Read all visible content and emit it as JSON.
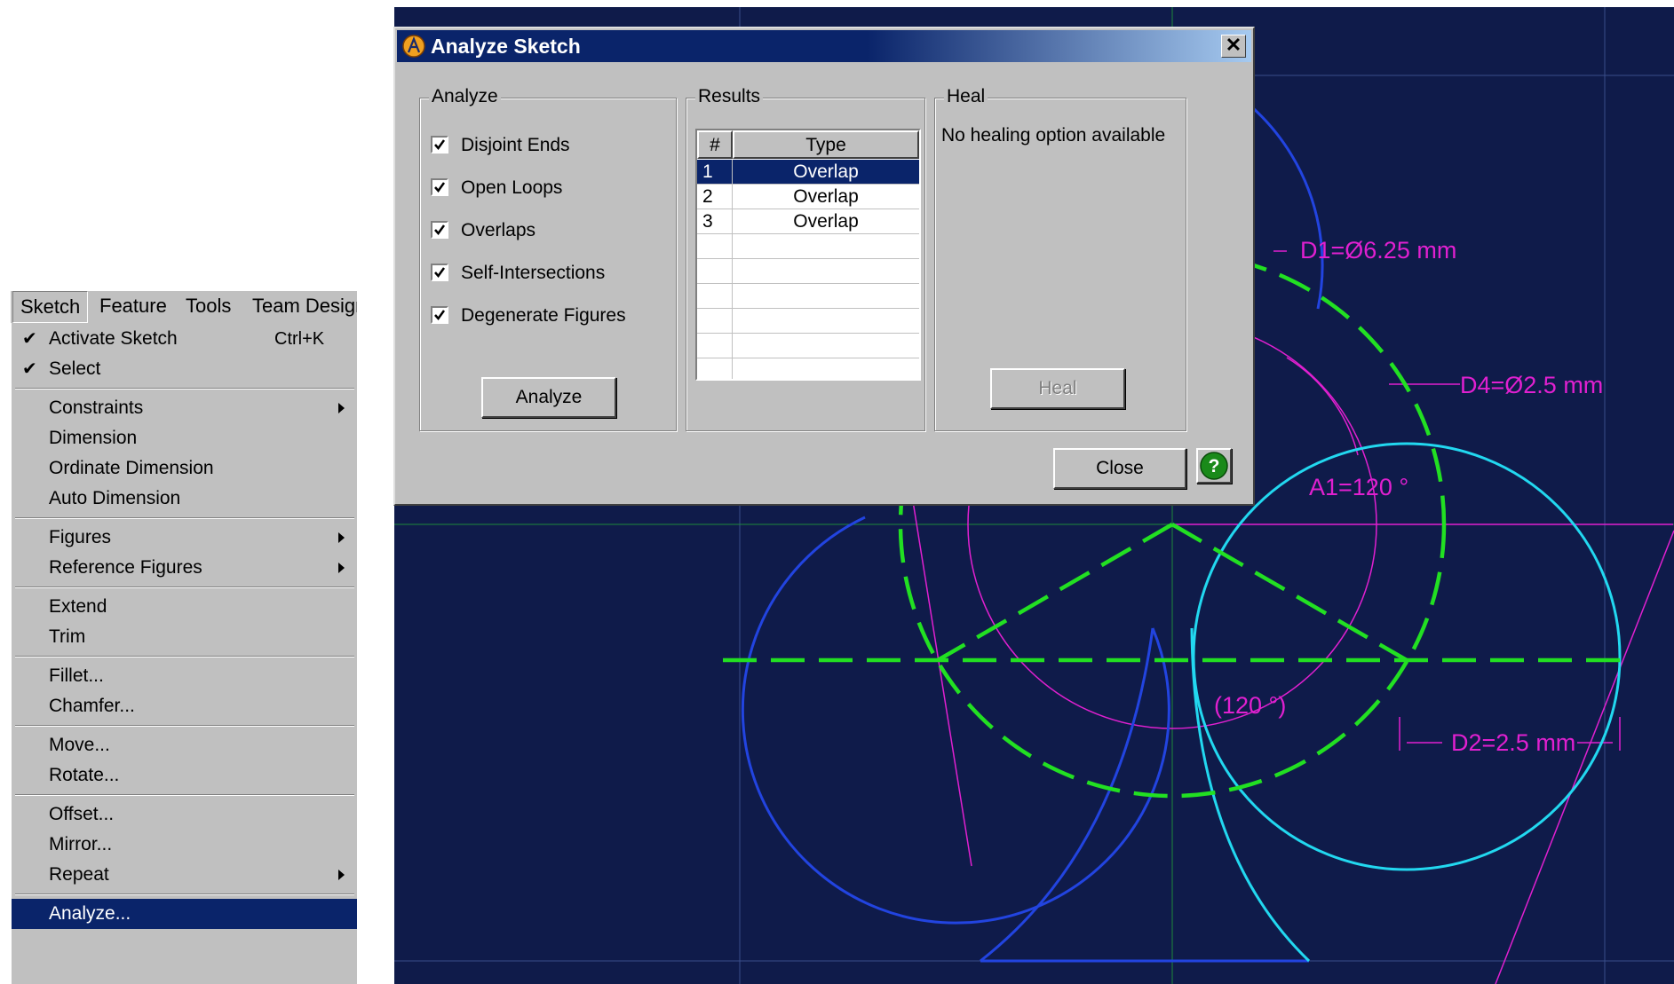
{
  "menu": {
    "bar": [
      "Sketch",
      "Feature",
      "Tools",
      "Team Design"
    ],
    "items": [
      {
        "label": "Activate Sketch",
        "shortcut": "Ctrl+K",
        "checked": true
      },
      {
        "label": "Select",
        "checked": true
      },
      {
        "label": "Constraints",
        "submenu": true
      },
      {
        "label": "Dimension"
      },
      {
        "label": "Ordinate Dimension"
      },
      {
        "label": "Auto Dimension"
      },
      {
        "label": "Figures",
        "submenu": true
      },
      {
        "label": "Reference Figures",
        "submenu": true
      },
      {
        "label": "Extend"
      },
      {
        "label": "Trim"
      },
      {
        "label": "Fillet..."
      },
      {
        "label": "Chamfer..."
      },
      {
        "label": "Move..."
      },
      {
        "label": "Rotate..."
      },
      {
        "label": "Offset..."
      },
      {
        "label": "Mirror..."
      },
      {
        "label": "Repeat",
        "submenu": true
      },
      {
        "label": "Analyze...",
        "highlighted": true
      }
    ]
  },
  "dialog": {
    "title": "Analyze Sketch",
    "close_glyph": "✕",
    "analyze_group": "Analyze",
    "options": [
      {
        "label": "Disjoint Ends",
        "checked": true
      },
      {
        "label": "Open Loops",
        "checked": true
      },
      {
        "label": "Overlaps",
        "checked": true
      },
      {
        "label": "Self-Intersections",
        "checked": true
      },
      {
        "label": "Degenerate Figures",
        "checked": true
      }
    ],
    "analyze_button": "Analyze",
    "results_group": "Results",
    "columns": [
      "#",
      "Type"
    ],
    "rows": [
      {
        "num": "1",
        "type": "Overlap",
        "selected": true
      },
      {
        "num": "2",
        "type": "Overlap"
      },
      {
        "num": "3",
        "type": "Overlap"
      }
    ],
    "heal_group": "Heal",
    "heal_message": "No healing option available",
    "heal_button": "Heal",
    "close_button": "Close",
    "help_glyph": "?"
  },
  "sketch": {
    "dimensions": {
      "d1": "D1=Ø6.25 mm",
      "d4": "D4=Ø2.5 mm",
      "a1": "A1=120 °",
      "a2": "(120 °)",
      "d2": "D2=2.5 mm"
    },
    "colors": {
      "background": "#0f1b4a",
      "blue_figure": "#2244e0",
      "cyan_figure": "#22d8f0",
      "green_figure": "#22e022",
      "dimension": "#e020d0"
    }
  }
}
